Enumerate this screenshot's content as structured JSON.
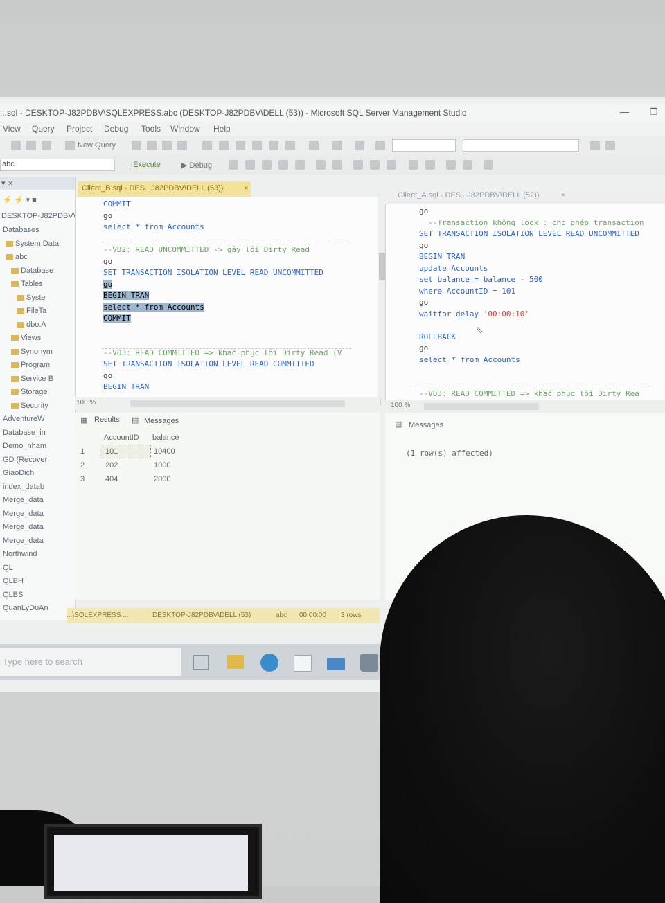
{
  "window": {
    "title": "...sql - DESKTOP-J82PDBV\\SQLEXPRESS.abc (DESKTOP-J82PDBV\\DELL (53)) - Microsoft SQL Server Management Studio"
  },
  "menu": [
    "View",
    "Query",
    "Project",
    "Debug",
    "Tools",
    "Window",
    "Help"
  ],
  "toolbar": {
    "new_query": "New Query",
    "database_selector": "abc",
    "execute": "! Execute",
    "debug": "▶ Debug"
  },
  "explorer": {
    "server": "DESKTOP-J82PDBV\\",
    "items": [
      "Databases",
      "System Data",
      "abc",
      "Database",
      "Tables",
      "Syste",
      "FileTa",
      "dbo.A",
      "Views",
      "Synonym",
      "Program",
      "Service B",
      "Storage",
      "Security",
      "AdventureW",
      "Database_in",
      "Demo_nham",
      "GD (Recover",
      "GiaoDich",
      "index_datab",
      "Merge_data",
      "Merge_data",
      "Merge_data",
      "Merge_data",
      "Northwind",
      "QL",
      "QLBH",
      "QLBS",
      "QuanLyDuAn"
    ]
  },
  "left_pane": {
    "tab": "Client_B.sql - DES...J82PDBV\\DELL (53))",
    "lines": [
      {
        "cls": "kw",
        "text": "COMMIT"
      },
      {
        "cls": "txt",
        "text": "go"
      },
      {
        "cls": "kw",
        "text": "select * from Accounts"
      },
      {
        "cls": "txt",
        "text": ""
      },
      {
        "cls": "cm",
        "text": "--VD2: READ UNCOMMITTED -> gây lỗi Dirty Read"
      },
      {
        "cls": "txt",
        "text": "go"
      },
      {
        "cls": "kw",
        "text": "SET TRANSACTION ISOLATION LEVEL READ UNCOMMITTED"
      },
      {
        "cls": "sel",
        "text": "go"
      },
      {
        "cls": "sel",
        "text": "BEGIN TRAN"
      },
      {
        "cls": "sel",
        "text": "select * from Accounts"
      },
      {
        "cls": "sel",
        "text": "COMMIT"
      },
      {
        "cls": "txt",
        "text": ""
      },
      {
        "cls": "txt",
        "text": ""
      },
      {
        "cls": "cm",
        "text": "--VD3: READ COMMITTED => khắc phục lỗi Dirty Read (V"
      },
      {
        "cls": "kw",
        "text": "SET TRANSACTION ISOLATION LEVEL READ COMMITTED"
      },
      {
        "cls": "txt",
        "text": "go"
      },
      {
        "cls": "kw",
        "text": "BEGIN TRAN"
      }
    ],
    "zoom": "100 %",
    "results_tab": "Results",
    "messages_tab": "Messages",
    "columns": [
      "AccountID",
      "balance"
    ],
    "rows": [
      [
        "1",
        "101",
        "10400"
      ],
      [
        "2",
        "202",
        "1000"
      ],
      [
        "3",
        "404",
        "2000"
      ]
    ]
  },
  "right_pane": {
    "tab": "Client_A.sql - DES...J82PDBV\\DELL (52))",
    "lines": [
      {
        "cls": "txt",
        "text": "go"
      },
      {
        "cls": "cm",
        "text": "  --Transaction không lock : cho phép transaction"
      },
      {
        "cls": "kw",
        "text": "SET TRANSACTION ISOLATION LEVEL READ UNCOMMITTED"
      },
      {
        "cls": "txt",
        "text": "go"
      },
      {
        "cls": "kw",
        "text": "BEGIN TRAN"
      },
      {
        "cls": "kw",
        "text": "update Accounts"
      },
      {
        "cls": "kw",
        "text": "set balance = balance - 500"
      },
      {
        "cls": "kw",
        "text": "where AccountID = 101"
      },
      {
        "cls": "txt",
        "text": "go"
      },
      {
        "cls": "mix",
        "text": "waitfor delay ",
        "str": "'00:00:10'"
      },
      {
        "cls": "txt",
        "text": ""
      },
      {
        "cls": "kw",
        "text": "ROLLBACK"
      },
      {
        "cls": "txt",
        "text": "go"
      },
      {
        "cls": "kw",
        "text": "select * from Accounts"
      },
      {
        "cls": "txt",
        "text": ""
      },
      {
        "cls": "txt",
        "text": ""
      },
      {
        "cls": "cm",
        "text": "--VD3: READ COMMITTED => khắc phục lỗi Dirty Rea"
      }
    ],
    "zoom": "100 %",
    "messages_tab": "Messages",
    "message": "(1 row(s) affected)"
  },
  "statusbar": {
    "server": "...\\SQLEXPRESS ...",
    "user": "DESKTOP-J82PDBV\\DELL (53)",
    "db": "abc",
    "time": "00:00:00",
    "rows": "3 rows"
  },
  "taskbar": {
    "search_placeholder": "Type here to search"
  }
}
